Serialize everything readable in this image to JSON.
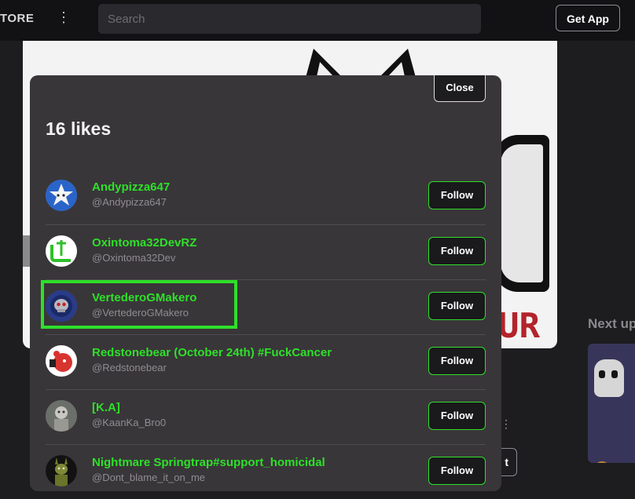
{
  "header": {
    "store_label": "TORE",
    "menu_icon": "kebab-menu-icon",
    "search_placeholder": "Search",
    "get_app_label": "Get App"
  },
  "background": {
    "next_up_label": "Next up",
    "thumb_overflow": "@...",
    "button_fragment": "t",
    "art_text": "UR"
  },
  "likes_modal": {
    "close_label": "Close",
    "title": "16 likes",
    "highlight_color": "#2ee02a",
    "users": [
      {
        "name": "Andypizza647",
        "handle": "@Andypizza647",
        "follow_label": "Follow",
        "avatar_icon": "star-avatar"
      },
      {
        "name": "Oxintoma32DevRZ",
        "handle": "@Oxintoma32Dev",
        "follow_label": "Follow",
        "avatar_icon": "green-logo-avatar"
      },
      {
        "name": "VertederoGMakero",
        "handle": "@VertederoGMakero",
        "follow_label": "Follow",
        "avatar_icon": "skull-avatar"
      },
      {
        "name": "Redstonebear (October 24th) #FuckCancer",
        "handle": "@Redstonebear",
        "follow_label": "Follow",
        "avatar_icon": "red-bear-avatar"
      },
      {
        "name": "[K.A]",
        "handle": "@KaanKa_Bro0",
        "follow_label": "Follow",
        "avatar_icon": "character-avatar"
      },
      {
        "name": "Nightmare Springtrap#support_homicidal",
        "handle": "@Dont_blame_it_on_me",
        "follow_label": "Follow",
        "avatar_icon": "springtrap-avatar"
      }
    ]
  }
}
